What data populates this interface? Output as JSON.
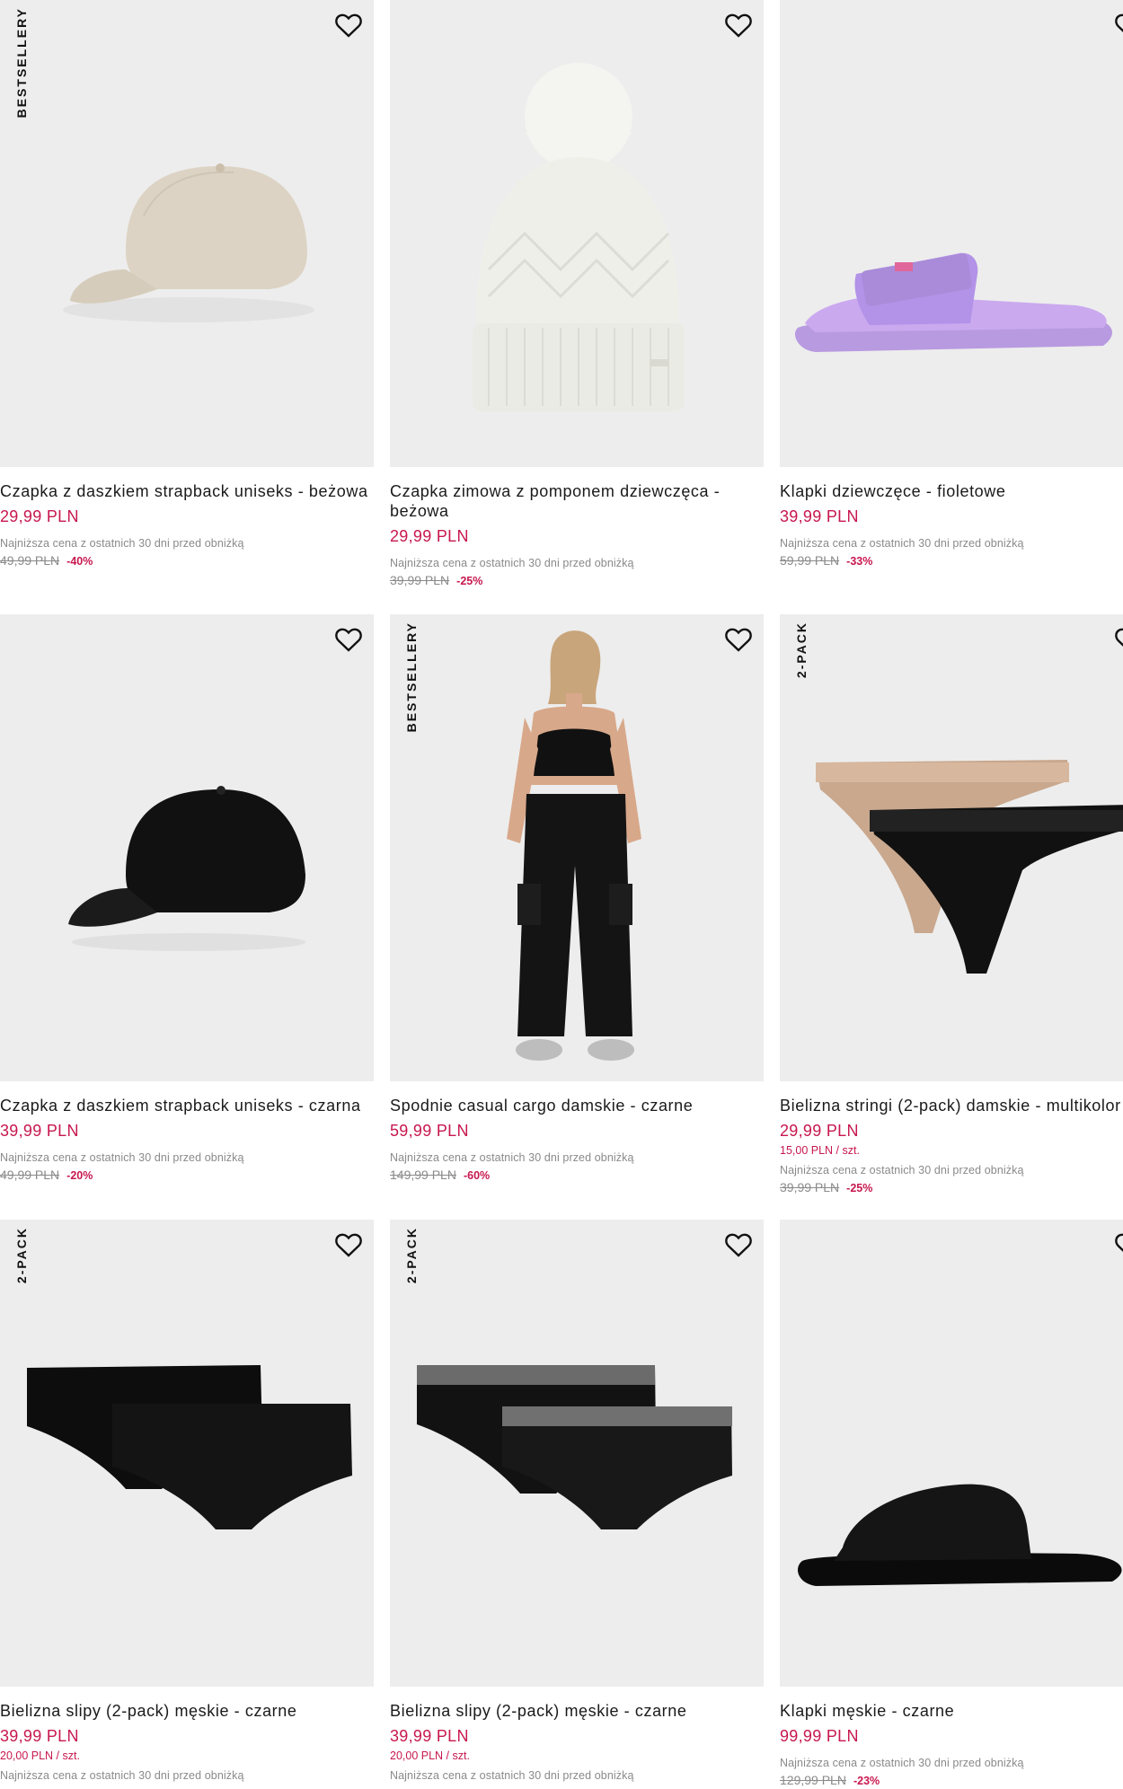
{
  "colors": {
    "accent": "#c7174f",
    "muted": "#8a8a8a",
    "tile": "#ededed"
  },
  "products": [
    {
      "badge": "BESTSELLERY",
      "title": "Czapka z daszkiem strapback uniseks - beżowa",
      "price": "29,99 PLN",
      "unit": "",
      "note": "Najniższa cena z ostatnich 30 dni przed obniżką",
      "old": "49,99 PLN",
      "discount": "-40%",
      "icon": "heart-icon"
    },
    {
      "badge": "",
      "title": "Czapka zimowa z pomponem dziewczęca - beżowa",
      "price": "29,99 PLN",
      "unit": "",
      "note": "Najniższa cena z ostatnich 30 dni przed obniżką",
      "old": "39,99 PLN",
      "discount": "-25%",
      "icon": "heart-icon"
    },
    {
      "badge": "",
      "title": "Klapki dziewczęce - fioletowe",
      "price": "39,99 PLN",
      "unit": "",
      "note": "Najniższa cena z ostatnich 30 dni przed obniżką",
      "old": "59,99 PLN",
      "discount": "-33%",
      "icon": "heart-icon"
    },
    {
      "badge": "",
      "title": "Czapka z daszkiem strapback uniseks - czarna",
      "price": "39,99 PLN",
      "unit": "",
      "note": "Najniższa cena z ostatnich 30 dni przed obniżką",
      "old": "49,99 PLN",
      "discount": "-20%",
      "icon": "heart-icon"
    },
    {
      "badge": "BESTSELLERY",
      "title": "Spodnie casual cargo damskie - czarne",
      "price": "59,99 PLN",
      "unit": "",
      "note": "Najniższa cena z ostatnich 30 dni przed obniżką",
      "old": "149,99 PLN",
      "discount": "-60%",
      "icon": "heart-icon"
    },
    {
      "badge": "2-PACK",
      "title": "Bielizna stringi (2-pack) damskie - multikolor",
      "price": "29,99 PLN",
      "unit": "15,00 PLN / szt.",
      "note": "Najniższa cena z ostatnich 30 dni przed obniżką",
      "old": "39,99 PLN",
      "discount": "-25%",
      "icon": "heart-icon"
    },
    {
      "badge": "2-PACK",
      "title": "Bielizna slipy (2-pack) męskie - czarne",
      "price": "39,99 PLN",
      "unit": "20,00 PLN / szt.",
      "note": "Najniższa cena z ostatnich 30 dni przed obniżką",
      "old": "",
      "discount": "",
      "icon": "heart-icon"
    },
    {
      "badge": "2-PACK",
      "title": "Bielizna slipy (2-pack) męskie - czarne",
      "price": "39,99 PLN",
      "unit": "20,00 PLN / szt.",
      "note": "Najniższa cena z ostatnich 30 dni przed obniżką",
      "old": "",
      "discount": "",
      "icon": "heart-icon"
    },
    {
      "badge": "",
      "title": "Klapki męskie - czarne",
      "price": "99,99 PLN",
      "unit": "",
      "note": "Najniższa cena z ostatnich 30 dni przed obniżką",
      "old": "129,99 PLN",
      "discount": "-23%",
      "icon": "heart-icon"
    }
  ]
}
